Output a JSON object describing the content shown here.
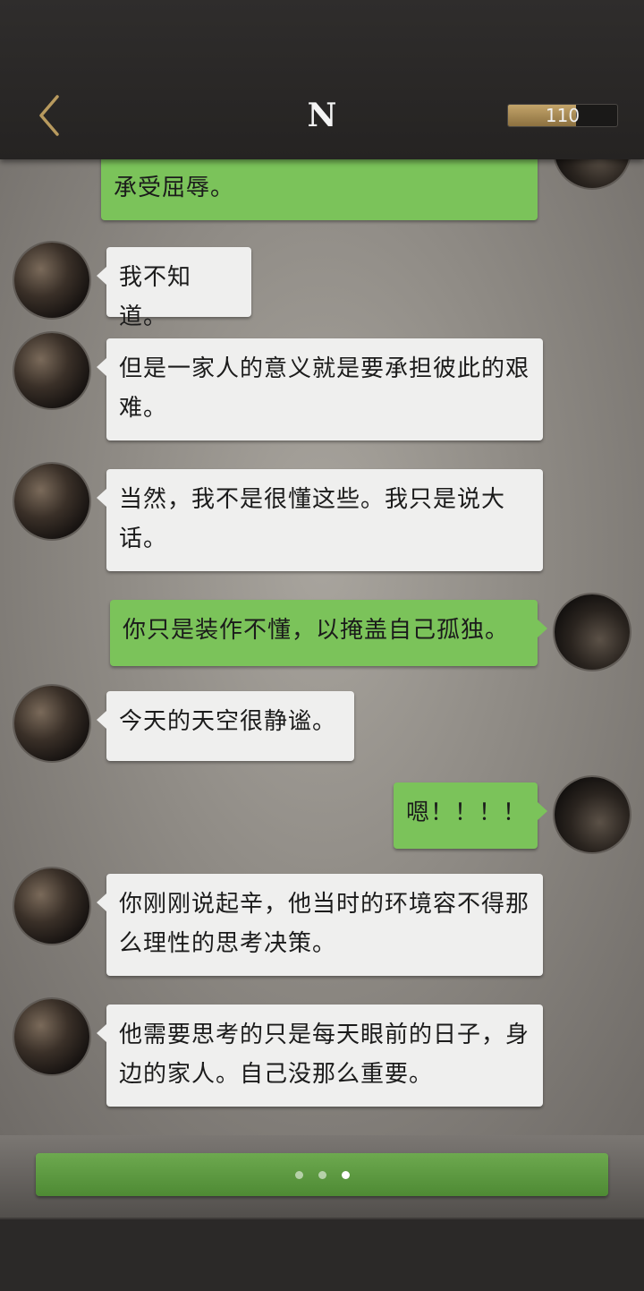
{
  "header": {
    "title": "N",
    "counter_value": "110",
    "counter_fill_fraction": 0.62
  },
  "icons": {
    "back": "chevron-left-icon"
  },
  "colors": {
    "accent_gold": "#b89a5e",
    "bubble_green": "#7bc35a",
    "bubble_white": "#efefee",
    "button_green": "#5e9c42"
  },
  "messages": [
    {
      "side": "right",
      "text": "承受屈辱。"
    },
    {
      "side": "left",
      "text": "我不知道。"
    },
    {
      "side": "left",
      "text": "但是一家人的意义就是要承担彼此的艰难。"
    },
    {
      "side": "left",
      "text": "当然，我不是很懂这些。我只是说大话。"
    },
    {
      "side": "right",
      "text": "你只是装作不懂，以掩盖自己孤独。"
    },
    {
      "side": "left",
      "text": "今天的天空很静谧。"
    },
    {
      "side": "right",
      "text": "嗯！！！！"
    },
    {
      "side": "left",
      "text": "你刚刚说起辛，他当时的环境容不得那么理性的思考决策。"
    },
    {
      "side": "left",
      "text": "他需要思考的只是每天眼前的日子，身边的家人。自己没那么重要。"
    }
  ],
  "typing_indicator": {
    "dots": 3,
    "active_dot_index": 2
  }
}
